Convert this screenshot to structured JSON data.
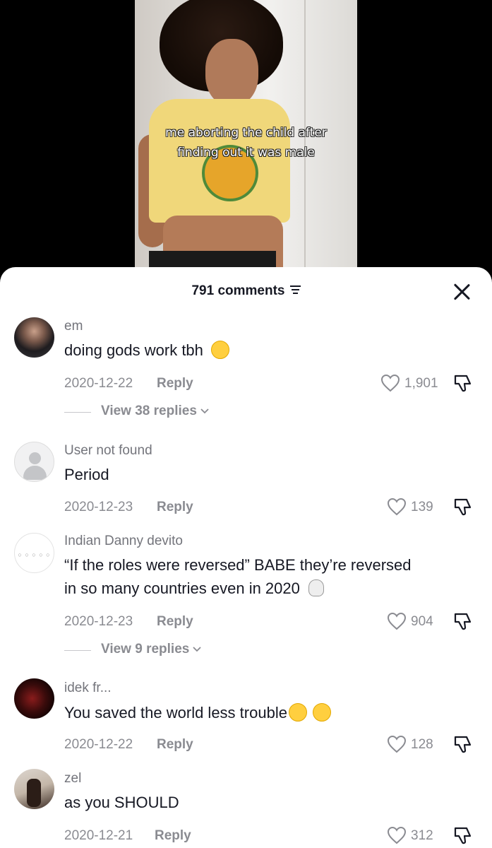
{
  "video": {
    "caption_line1": "me aborting the child after",
    "caption_line2": "finding out it was male"
  },
  "sheet": {
    "comments_count": "791 comments"
  },
  "comments": [
    {
      "username": "em",
      "text": "doing gods work tbh",
      "emoji": [
        "yum-face"
      ],
      "date": "2020-12-22",
      "reply_label": "Reply",
      "likes": "1,901",
      "view_replies": "View 38 replies"
    },
    {
      "username": "User not found",
      "text": "Period",
      "date": "2020-12-23",
      "reply_label": "Reply",
      "likes": "139"
    },
    {
      "username": "Indian Danny devito",
      "text_line1": "“If the roles were reversed” BABE they’re reversed",
      "text_line2": "in so many countries even in 2020",
      "emoji": [
        "skull"
      ],
      "date": "2020-12-23",
      "reply_label": "Reply",
      "likes": "904",
      "view_replies": "View 9 replies"
    },
    {
      "username": "idek fr...",
      "text": "You saved the world less trouble",
      "emoji": [
        "grin",
        "relieved-face"
      ],
      "date": "2020-12-22",
      "reply_label": "Reply",
      "likes": "128"
    },
    {
      "username": "zel",
      "text": "as you SHOULD",
      "date": "2020-12-21",
      "reply_label": "Reply",
      "likes": "312"
    }
  ]
}
